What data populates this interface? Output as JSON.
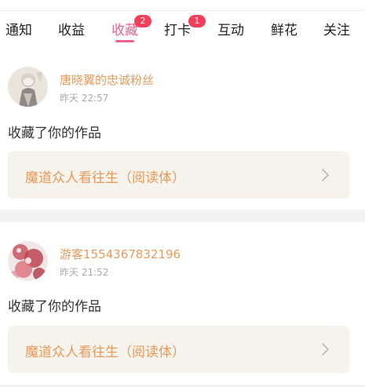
{
  "tabs": [
    {
      "label": "通知"
    },
    {
      "label": "收益"
    },
    {
      "label": "收藏",
      "badge": "2",
      "active": true
    },
    {
      "label": "打卡",
      "badge": "1"
    },
    {
      "label": "互动"
    },
    {
      "label": "鲜花"
    },
    {
      "label": "关注"
    }
  ],
  "notifications": [
    {
      "username": "唐晓翼的忠诚粉丝",
      "time": "昨天 22:57",
      "action": "收藏了你的作品",
      "work_title": "魔道众人看往生（阅读体）"
    },
    {
      "username": "游客1554367832196",
      "time": "昨天 21:52",
      "action": "收藏了你的作品",
      "work_title": "魔道众人看往生（阅读体）"
    }
  ],
  "colors": {
    "accent": "#e8638f",
    "badge": "#f2405a",
    "username": "#e89a5c",
    "work_box_bg": "#f5f3ec"
  }
}
